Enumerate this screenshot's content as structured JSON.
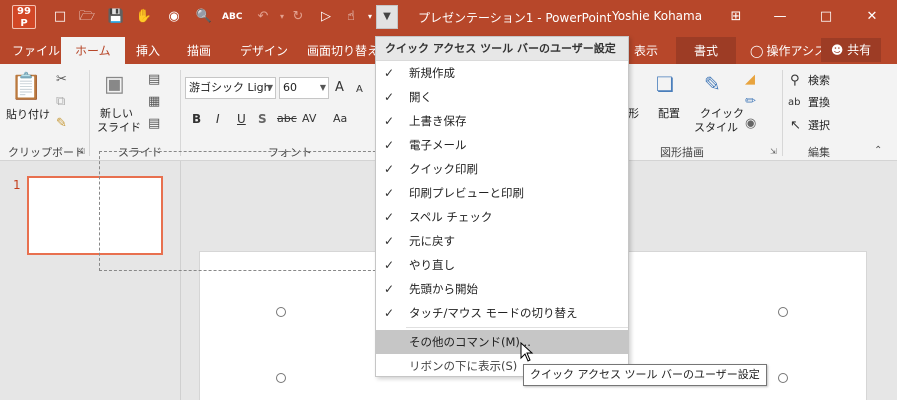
{
  "titlebar": {
    "app_icon_top": "99",
    "app_icon_bottom": "P",
    "title": "プレゼンテーション1 - PowerPoint",
    "user": "Yoshie Kohama",
    "qat_icons": [
      "new-file-icon",
      "open-folder-icon",
      "save-icon",
      "touch-mode-icon",
      "camera-icon",
      "print-preview-icon",
      "spell-check-icon",
      "undo-icon",
      "redo-icon",
      "start-slideshow-icon",
      "touch-mouse-mode-icon",
      "customize-qat-icon"
    ],
    "window_buttons": [
      "ribbon-display-icon",
      "minimize-icon",
      "maximize-icon",
      "close-icon"
    ]
  },
  "tabs": {
    "file": "ファイル",
    "home": "ホーム",
    "insert": "挿入",
    "draw": "描画",
    "design": "デザイン",
    "transitions": "画面切り替え",
    "view": "表示",
    "format": "書式",
    "tell_me": "操作アシス",
    "share": "共有"
  },
  "ribbon": {
    "clipboard": {
      "label": "クリップボード",
      "paste": "貼り付け"
    },
    "slides": {
      "label": "スライド",
      "new_slide_line1": "新しい",
      "new_slide_line2": "スライド"
    },
    "font": {
      "label": "フォント",
      "font_name": "游ゴシック Ligh",
      "font_size": "60",
      "bold": "B",
      "italic": "I",
      "underline": "U",
      "shadow": "S",
      "strike": "abc",
      "spacing": "AV",
      "case": "Aa",
      "grow": "A",
      "shrink": "A"
    },
    "drawing": {
      "label": "図形描画",
      "shape_partial": "形",
      "arrange": "配置",
      "quick_style_line1": "クイック",
      "quick_style_line2": "スタイル"
    },
    "editing": {
      "label": "編集",
      "find": "検索",
      "replace": "置換",
      "select": "選択"
    }
  },
  "thumbnails": {
    "slide_number": "1"
  },
  "qat_menu": {
    "header": "クイック アクセス ツール バーのユーザー設定",
    "items": [
      {
        "label": "新規作成",
        "checked": true
      },
      {
        "label": "開く",
        "checked": true
      },
      {
        "label": "上書き保存",
        "checked": true
      },
      {
        "label": "電子メール",
        "checked": true
      },
      {
        "label": "クイック印刷",
        "checked": true
      },
      {
        "label": "印刷プレビューと印刷",
        "checked": true
      },
      {
        "label": "スペル チェック",
        "checked": true
      },
      {
        "label": "元に戻す",
        "checked": true
      },
      {
        "label": "やり直し",
        "checked": true
      },
      {
        "label": "先頭から開始",
        "checked": true
      },
      {
        "label": "タッチ/マウス モードの切り替え",
        "checked": true
      }
    ],
    "more_commands": "その他のコマンド(M)...",
    "show_below": "リボンの下に表示(S)",
    "check_glyph": "✓"
  },
  "tooltip": "クイック アクセス ツール バーのユーザー設定",
  "colors": {
    "accent": "#b7472a",
    "active_tab_bg": "#f3f3f3",
    "menu_hover": "#c6c6c6"
  }
}
